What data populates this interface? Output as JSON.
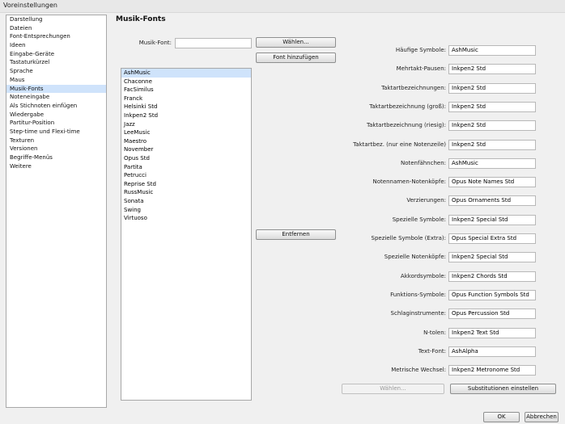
{
  "window": {
    "title": "Voreinstellungen"
  },
  "sidebar": {
    "selected_index": 9,
    "items": [
      "Darstellung",
      "Dateien",
      "Font-Entsprechungen",
      "Ideen",
      "Eingabe-Geräte",
      "Tastaturkürzel",
      "Sprache",
      "Maus",
      "Musik-Fonts",
      "Noteneingabe",
      "Als Stichnoten einfügen",
      "Wiedergabe",
      "Partitur-Position",
      "Step-time und Flexi-time",
      "Texturen",
      "Versionen",
      "Begriffe-Menüs",
      "Weitere"
    ]
  },
  "section": {
    "title": "Musik-Fonts"
  },
  "musik_font": {
    "label": "Musik-Font:",
    "value": ""
  },
  "buttons": {
    "waehlen": "Wählen...",
    "font_hinzufuegen": "Font hinzufügen",
    "entfernen": "Entfernen",
    "waehlen_disabled": "Wählen...",
    "substitutionen": "Substitutionen einstellen",
    "ok": "OK",
    "abbrechen": "Abbrechen"
  },
  "font_list": {
    "selected_index": 0,
    "items": [
      "AshMusic",
      "Chaconne",
      "FacSimilus",
      "Franck",
      "Helsinki Std",
      "Inkpen2 Std",
      "Jazz",
      "LeeMusic",
      "Maestro",
      "November",
      "Opus Std",
      "Partita",
      "Petrucci",
      "Reprise Std",
      "RussMusic",
      "Sonata",
      "Swing",
      "Virtuoso"
    ]
  },
  "symbols": [
    {
      "label": "Häufige Symbole:",
      "value": "AshMusic"
    },
    {
      "label": "Mehrtakt-Pausen:",
      "value": "Inkpen2 Std"
    },
    {
      "label": "Taktartbezeichnungen:",
      "value": "Inkpen2 Std"
    },
    {
      "label": "Taktartbezeichnung (groß):",
      "value": "Inkpen2 Std"
    },
    {
      "label": "Taktartbezeichnung (riesig):",
      "value": "Inkpen2 Std"
    },
    {
      "label": "Taktartbez. (nur eine Notenzeile)",
      "value": "Inkpen2 Std"
    },
    {
      "label": "Notenfähnchen:",
      "value": "AshMusic"
    },
    {
      "label": "Notennamen-Notenköpfe:",
      "value": "Opus Note Names Std"
    },
    {
      "label": "Verzierungen:",
      "value": "Opus Ornaments Std"
    },
    {
      "label": "Spezielle Symbole:",
      "value": "Inkpen2 Special Std"
    },
    {
      "label": "Spezielle Symbole (Extra):",
      "value": "Opus Special Extra Std"
    },
    {
      "label": "Spezielle Notenköpfe:",
      "value": "Inkpen2 Special Std"
    },
    {
      "label": "Akkordsymbole:",
      "value": "Inkpen2 Chords Std"
    },
    {
      "label": "Funktions-Symbole:",
      "value": "Opus Function Symbols Std"
    },
    {
      "label": "Schlaginstrumente:",
      "value": "Opus Percussion Std"
    },
    {
      "label": "N-tolen:",
      "value": "Inkpen2 Text Std"
    },
    {
      "label": "Text-Font:",
      "value": "AshAlpha"
    },
    {
      "label": "Metrische Wechsel:",
      "value": "Inkpen2 Metronome Std"
    }
  ]
}
